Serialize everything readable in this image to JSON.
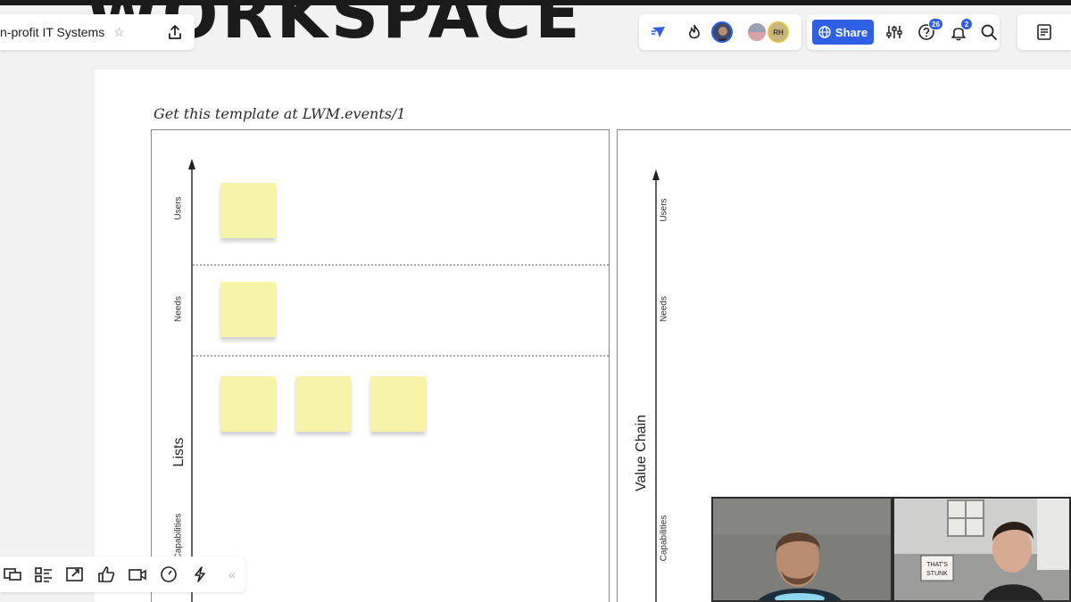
{
  "app": {
    "brand_wordmark": "WORKSPACE",
    "board_title": "n-profit IT Systems",
    "accent_color": "#2f5fe3"
  },
  "header": {
    "share_label": "Share",
    "collaborator_initials": "RH",
    "help_badge": "26",
    "notification_badge": "2",
    "icons": [
      "star-icon",
      "export-icon",
      "cursor-follow-icon",
      "flame-icon",
      "avatar",
      "settings-sliders-icon",
      "help-icon",
      "bell-icon",
      "search-icon",
      "notes-icon"
    ]
  },
  "canvas": {
    "template_link": "Get this template at LWM.events/1",
    "frames": [
      {
        "title": "Lists",
        "lanes": [
          "Users",
          "Needs",
          "Capabilities"
        ],
        "sticky_note_color": "#f7f4a9",
        "sticky_notes": 5
      },
      {
        "title": "Value Chain",
        "lanes": [
          "Users",
          "Needs",
          "Capabilities"
        ]
      }
    ]
  },
  "bottom_toolbar": {
    "icons": [
      "frames-icon",
      "layout-icon",
      "share-screen-icon",
      "reaction-icon",
      "video-icon",
      "timer-icon",
      "lightning-icon",
      "collapse-icon"
    ]
  },
  "video_tiles": [
    {
      "name": "participant-1"
    },
    {
      "name": "participant-2",
      "sign_text": "THAT'S\nSTUNK"
    }
  ]
}
